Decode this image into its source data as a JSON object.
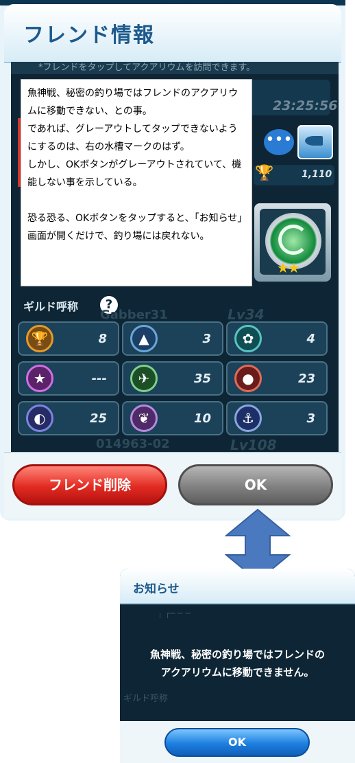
{
  "friend_dialog": {
    "title": "フレンド情報",
    "hint": "*フレンドをタップしてアクアリウムを訪問できます。",
    "timer": "23:25:56",
    "trophy_count": "1,110",
    "guild_label": "ギルド呼称",
    "behind_name": "Gabber31",
    "behind_level": "Lv34",
    "behind_id": "014963-02",
    "behind_level_2": "Lv108",
    "guild_titles": [
      {
        "icon": "trophy-icon",
        "value": "8"
      },
      {
        "icon": "shark-icon",
        "value": "3"
      },
      {
        "icon": "paw-icon",
        "value": "4"
      },
      {
        "icon": "star-icon",
        "value": "---"
      },
      {
        "icon": "bird-icon",
        "value": "35"
      },
      {
        "icon": "bomb-icon",
        "value": "23"
      },
      {
        "icon": "mask-icon",
        "value": "25"
      },
      {
        "icon": "rabbit-icon",
        "value": "10"
      },
      {
        "icon": "ship-icon",
        "value": "3"
      }
    ],
    "delete_button": "フレンド削除",
    "ok_button": "OK"
  },
  "annotation": {
    "lines": [
      "魚神戦、秘密の釣り場ではフレンドのアクアリウムに移動できない、との事。",
      "であれば、グレーアウトしてタップできないようにするのは、右の水槽マークのはず。",
      "しかし、OKボタンがグレーアウトされていて、機能しない事を示している。",
      "",
      "恐る恐る、OKボタンをタップすると、「お知らせ」画面が開くだけで、釣り場には戻れない。"
    ]
  },
  "notice_dialog": {
    "title": "お知らせ",
    "message_line1": "魚神戦、秘密の釣り場ではフレンドの",
    "message_line2": "アクアリウムに移動できません。",
    "ok_button": "OK"
  },
  "colors": {
    "title_blue": "#1d5a8c",
    "panel_dark": "#0d2534",
    "delete_red": "#e22b22",
    "ok_gray": "#818181",
    "notice_ok_blue": "#1d7fe0",
    "arrow_blue": "#4a79c0"
  }
}
